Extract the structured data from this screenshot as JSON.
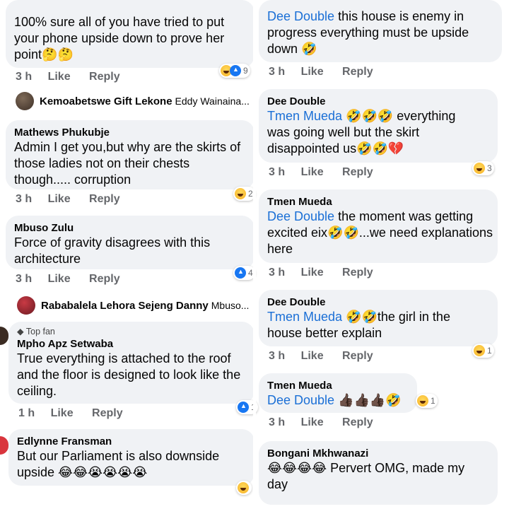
{
  "left": {
    "c1": {
      "text": "100% sure all of you have tried to put your phone upside down to prove her point🤔🤔",
      "time": "3 h",
      "like": "Like",
      "reply": "Reply",
      "reaction_count": "9"
    },
    "r1": {
      "name": "Kemoabetswe Gift Lekone",
      "rest": "Eddy Wainaina..."
    },
    "c2": {
      "name": "Mathews Phukubje",
      "text": "Admin I get you,but why are the skirts of those ladies not on their chests though..... corruption",
      "time": "3 h",
      "like": "Like",
      "reply": "Reply",
      "reaction_count": "2"
    },
    "c3": {
      "name": "Mbuso Zulu",
      "text": "Force of gravity disagrees with this architecture",
      "time": "3 h",
      "like": "Like",
      "reply": "Reply",
      "reaction_count": "4"
    },
    "r2": {
      "name": "Rababalela Lehora Sejeng Danny",
      "rest": "Mbuso..."
    },
    "c4": {
      "badge": "Top fan",
      "name": "Mpho Apz Setwaba",
      "text": "True everything is attached to the roof and the floor is designed to look like the ceiling.",
      "time": "1 h",
      "like": "Like",
      "reply": "Reply",
      "reaction_count": "1"
    },
    "c5": {
      "name": "Edlynne Fransman",
      "text": "But our Parliament is also downside upside 😂😂😭😭😭😭"
    }
  },
  "right": {
    "c1": {
      "mention": "Dee Double",
      "text": " this house is enemy in progress everything must be upside down 🤣",
      "time": "3 h",
      "like": "Like",
      "reply": "Reply"
    },
    "c2": {
      "name": "Dee Double",
      "mention": "Tmen Mueda",
      "text": " 🤣🤣🤣 everything was going well but the skirt disappointed us🤣🤣💔",
      "time": "3 h",
      "like": "Like",
      "reply": "Reply",
      "reaction_count": "3"
    },
    "c3": {
      "name": "Tmen Mueda",
      "mention": "Dee Double",
      "text": " the moment was getting excited eix🤣🤣...we need explanations here",
      "time": "3 h",
      "like": "Like",
      "reply": "Reply"
    },
    "c4": {
      "name": "Dee Double",
      "mention": "Tmen Mueda",
      "text": " 🤣🤣the girl in the house better explain",
      "time": "3 h",
      "like": "Like",
      "reply": "Reply",
      "reaction_count": "1"
    },
    "c5": {
      "name": "Tmen Mueda",
      "mention": "Dee Double",
      "text": " 👍🏿👍🏿👍🏿🤣",
      "time": "3 h",
      "like": "Like",
      "reply": "Reply",
      "reaction_count": "1"
    },
    "c6": {
      "name": "Bongani Mkhwanazi",
      "text": "😂😂😂😂 Pervert OMG, made my day"
    }
  },
  "colors": {
    "bubble": "#f0f2f5",
    "mention": "#1a6fd6",
    "meta": "#65676b",
    "like_blue": "#1877f2",
    "haha_yellow": "#f7b125"
  },
  "icons": {
    "haha": "haha-reaction-icon",
    "like": "like-reaction-icon",
    "top_fan": "diamond-icon"
  }
}
